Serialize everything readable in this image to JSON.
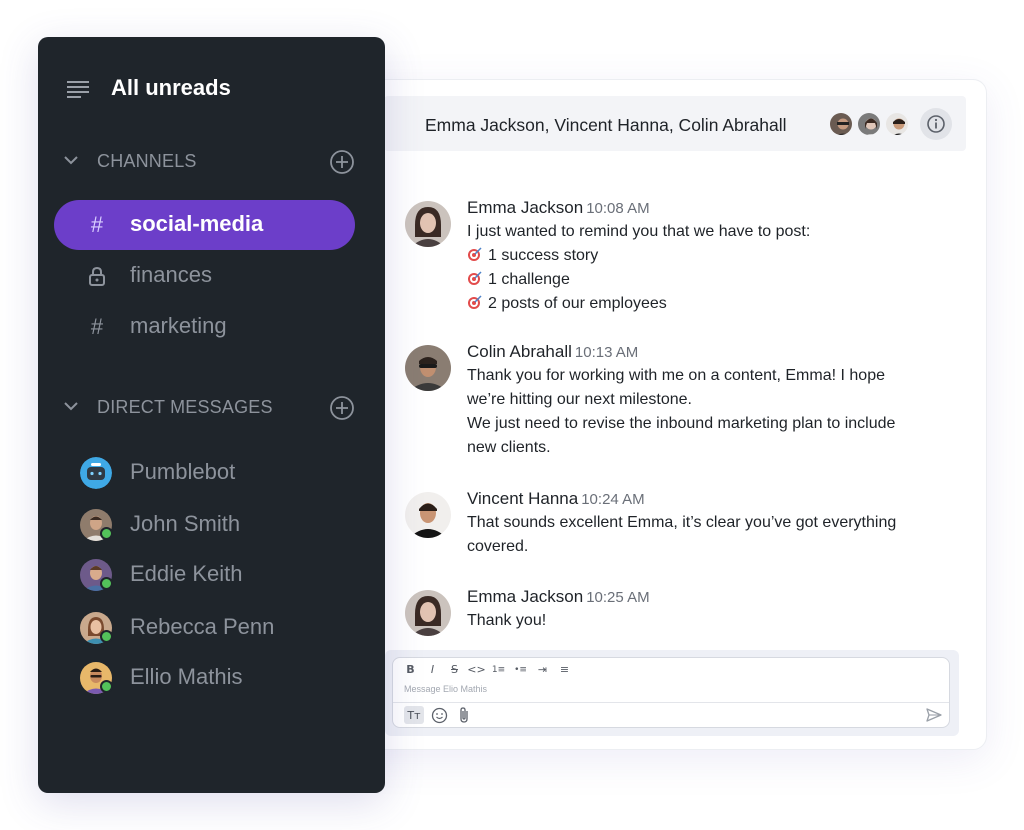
{
  "sidebar": {
    "title": "All unreads",
    "channels_header": "CHANNELS",
    "channels": [
      {
        "label": "social-media",
        "icon": "hash-icon",
        "active": true
      },
      {
        "label": "finances",
        "icon": "lock-icon",
        "active": false
      },
      {
        "label": "marketing",
        "icon": "hash-icon",
        "active": false
      }
    ],
    "dm_header": "DIRECT MESSAGES",
    "direct_messages": [
      {
        "label": "Pumblebot",
        "online": false
      },
      {
        "label": "John Smith",
        "online": true
      },
      {
        "label": "Eddie Keith",
        "online": true
      },
      {
        "label": "Rebecca Penn",
        "online": true
      },
      {
        "label": "Ellio Mathis",
        "online": true
      }
    ]
  },
  "chat": {
    "title": "Emma Jackson, Vincent Hanna, Colin Abrahall",
    "messages": [
      {
        "author": "Emma Jackson",
        "time": "10:08 AM",
        "lines": [
          "I just wanted to remind you that we have to post:",
          "1 success story",
          "1 challenge",
          "2  posts of our employees"
        ]
      },
      {
        "author": "Colin Abrahall",
        "time": "10:13 AM",
        "lines": [
          "Thank you for working with me on a content, Emma! I hope",
          "we’re hitting our next milestone.",
          "We just need to revise the inbound marketing plan to include",
          "new clients."
        ]
      },
      {
        "author": "Vincent Hanna",
        "time": "10:24 AM",
        "lines": [
          "That sounds excellent Emma, it’s clear you’ve got everything",
          "covered."
        ]
      },
      {
        "author": "Emma Jackson",
        "time": "10:25 AM",
        "lines": [
          "Thank you!"
        ]
      }
    ]
  },
  "composer": {
    "placeholder": "Message Elio Mathis",
    "format_buttons": [
      "B",
      "I",
      "S",
      "<>",
      "1≡",
      "•≡",
      "⇥",
      "≡"
    ],
    "text_style_label": "Tт"
  },
  "colors": {
    "accent": "#6c3ec9",
    "sidebar_bg": "#1f252b",
    "online": "#53c25a"
  }
}
